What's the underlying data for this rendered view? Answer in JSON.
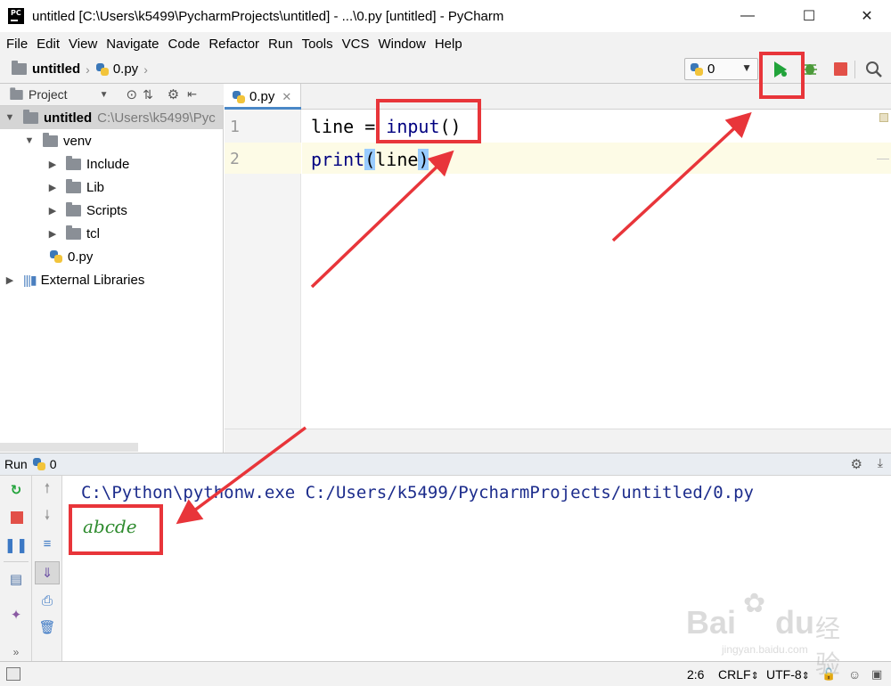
{
  "window": {
    "title": "untitled [C:\\Users\\k5499\\PycharmProjects\\untitled] - ...\\0.py [untitled] - PyCharm",
    "app_icon_label": "PC"
  },
  "menu": [
    "File",
    "Edit",
    "View",
    "Navigate",
    "Code",
    "Refactor",
    "Run",
    "Tools",
    "VCS",
    "Window",
    "Help"
  ],
  "navbar": {
    "crumb_project": "untitled",
    "crumb_file": "0.py",
    "run_config": "0"
  },
  "project_panel": {
    "header_label": "Project",
    "tree": [
      {
        "label": "untitled",
        "extra": "C:\\Users\\k5499\\Pyc"
      },
      {
        "label": "venv"
      },
      {
        "label": "Include"
      },
      {
        "label": "Lib"
      },
      {
        "label": "Scripts"
      },
      {
        "label": "tcl"
      },
      {
        "label": "0.py"
      },
      {
        "label": "External Libraries"
      }
    ]
  },
  "editor": {
    "tab_label": "0.py",
    "line_numbers": [
      "1",
      "2"
    ],
    "line1": {
      "var": "line",
      "op": " = ",
      "func": "input",
      "paren": "()"
    },
    "line2": {
      "func": "print",
      "open": "(",
      "arg": "line",
      "close": ")"
    }
  },
  "run_panel": {
    "header_label": "Run",
    "config_name": "0",
    "command": "C:\\Python\\pythonw.exe C:/Users/k5499/PycharmProjects/untitled/0.py",
    "output": "abcde"
  },
  "statusbar": {
    "position": "2:6",
    "line_sep": "CRLF",
    "encoding": "UTF-8"
  },
  "watermark": {
    "brand": "Bai",
    "brand2": "du",
    "cn": "经验",
    "url": "jingyan.baidu.com"
  },
  "colors": {
    "annotation": "#e8353a",
    "run_green": "#21a33a",
    "stop_red": "#e25048",
    "output_green": "#2e8b2e",
    "command_blue": "#1c2c8c"
  }
}
